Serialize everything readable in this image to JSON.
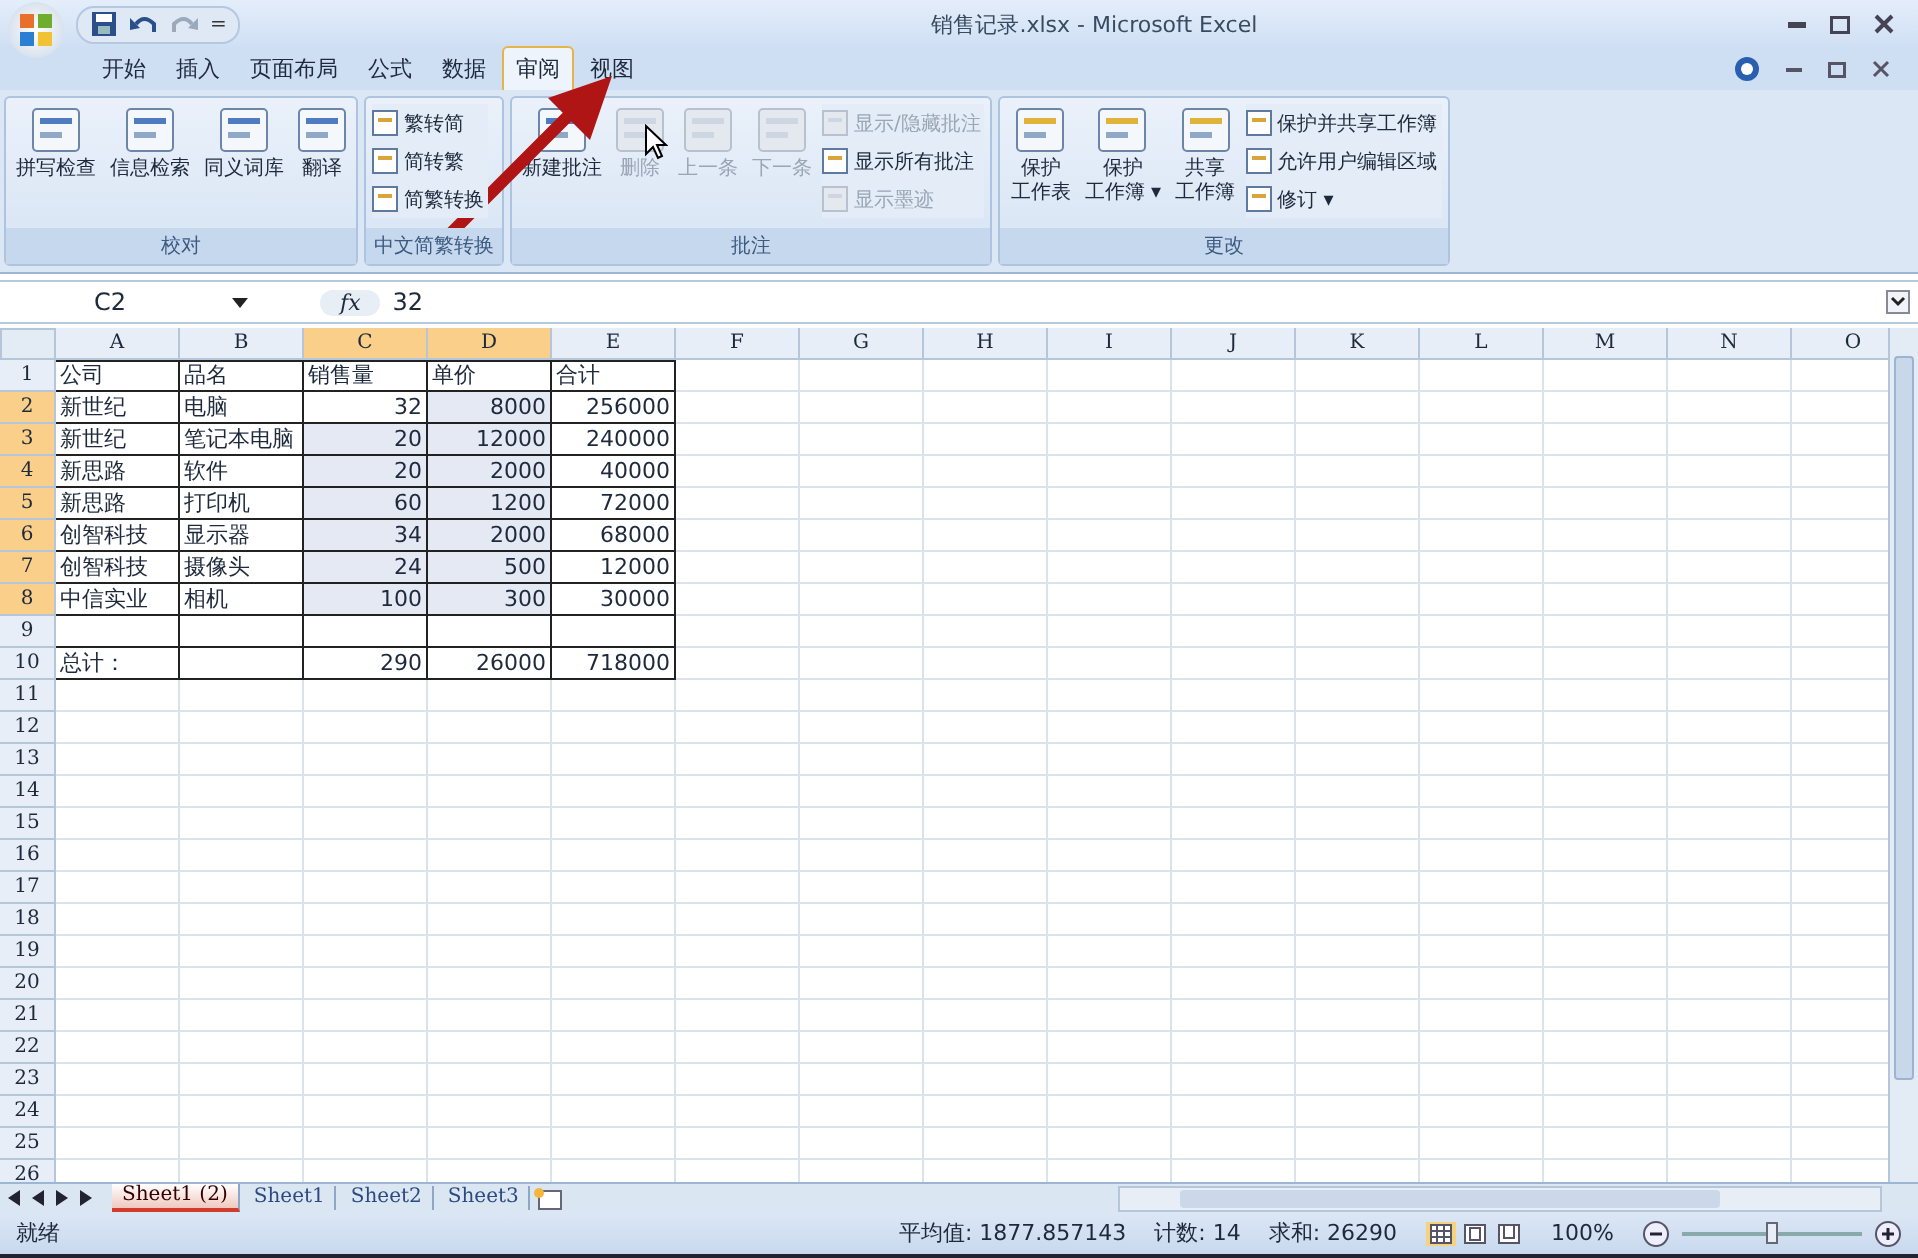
{
  "window": {
    "title": "销售记录.xlsx - Microsoft Excel"
  },
  "quick_access": {
    "customize": "="
  },
  "ribbon_tabs": [
    {
      "label": "开始",
      "selected": false
    },
    {
      "label": "插入",
      "selected": false
    },
    {
      "label": "页面布局",
      "selected": false
    },
    {
      "label": "公式",
      "selected": false
    },
    {
      "label": "数据",
      "selected": false
    },
    {
      "label": "审阅",
      "selected": true
    },
    {
      "label": "视图",
      "selected": false
    }
  ],
  "ribbon_groups": [
    {
      "label": "校对",
      "items": [
        {
          "kind": "large",
          "lines": [
            "拼写检查"
          ],
          "disabled": false
        },
        {
          "kind": "large",
          "lines": [
            "信息检索"
          ],
          "disabled": false
        },
        {
          "kind": "large",
          "lines": [
            "同义词库"
          ],
          "disabled": false
        },
        {
          "kind": "large",
          "lines": [
            "翻译"
          ],
          "disabled": false
        }
      ]
    },
    {
      "label": "中文简繁转换",
      "items": [
        {
          "kind": "small",
          "lines": [
            "繁转简"
          ],
          "disabled": false
        },
        {
          "kind": "small",
          "lines": [
            "简转繁"
          ],
          "disabled": false
        },
        {
          "kind": "small",
          "lines": [
            "简繁转换"
          ],
          "disabled": false
        }
      ]
    },
    {
      "label": "批注",
      "items": [
        {
          "kind": "large",
          "lines": [
            "新建批注"
          ],
          "disabled": false
        },
        {
          "kind": "large",
          "lines": [
            "删除"
          ],
          "disabled": true
        },
        {
          "kind": "large",
          "lines": [
            "上一条"
          ],
          "disabled": true
        },
        {
          "kind": "large",
          "lines": [
            "下一条"
          ],
          "disabled": true
        },
        {
          "kind": "small",
          "lines": [
            "显示/隐藏批注"
          ],
          "disabled": true
        },
        {
          "kind": "small",
          "lines": [
            "显示所有批注"
          ],
          "disabled": false
        },
        {
          "kind": "small",
          "lines": [
            "显示墨迹"
          ],
          "disabled": true
        }
      ]
    },
    {
      "label": "更改",
      "items": [
        {
          "kind": "large",
          "lines": [
            "保护",
            "工作表"
          ],
          "disabled": false
        },
        {
          "kind": "large",
          "lines": [
            "保护",
            "工作簿 ▾"
          ],
          "disabled": false
        },
        {
          "kind": "large",
          "lines": [
            "共享",
            "工作簿"
          ],
          "disabled": false
        },
        {
          "kind": "small",
          "lines": [
            "保护并共享工作簿"
          ],
          "disabled": false
        },
        {
          "kind": "small",
          "lines": [
            "允许用户编辑区域"
          ],
          "disabled": false
        },
        {
          "kind": "small",
          "lines": [
            "修订 ▾"
          ],
          "disabled": false
        }
      ]
    }
  ],
  "formula_bar": {
    "name_box": "C2",
    "fx": "fx",
    "value": "32"
  },
  "columns": [
    {
      "label": "A",
      "selected": false
    },
    {
      "label": "B",
      "selected": false
    },
    {
      "label": "C",
      "selected": true
    },
    {
      "label": "D",
      "selected": true
    },
    {
      "label": "E",
      "selected": false
    },
    {
      "label": "F",
      "selected": false
    },
    {
      "label": "G",
      "selected": false
    },
    {
      "label": "H",
      "selected": false
    },
    {
      "label": "I",
      "selected": false
    },
    {
      "label": "J",
      "selected": false
    },
    {
      "label": "K",
      "selected": false
    },
    {
      "label": "L",
      "selected": false
    },
    {
      "label": "M",
      "selected": false
    },
    {
      "label": "N",
      "selected": false
    },
    {
      "label": "O",
      "selected": false
    }
  ],
  "rows": [
    {
      "number": "1",
      "selected": false,
      "cells": [
        "公司",
        "品名",
        "销售量",
        "单价",
        "合计"
      ]
    },
    {
      "number": "2",
      "selected": true,
      "cells": [
        "新世纪",
        "电脑",
        "32",
        "8000",
        "256000"
      ]
    },
    {
      "number": "3",
      "selected": true,
      "cells": [
        "新世纪",
        "笔记本电脑",
        "20",
        "12000",
        "240000"
      ]
    },
    {
      "number": "4",
      "selected": true,
      "cells": [
        "新思路",
        "软件",
        "20",
        "2000",
        "40000"
      ]
    },
    {
      "number": "5",
      "selected": true,
      "cells": [
        "新思路",
        "打印机",
        "60",
        "1200",
        "72000"
      ]
    },
    {
      "number": "6",
      "selected": true,
      "cells": [
        "创智科技",
        "显示器",
        "34",
        "2000",
        "68000"
      ]
    },
    {
      "number": "7",
      "selected": true,
      "cells": [
        "创智科技",
        "摄像头",
        "24",
        "500",
        "12000"
      ]
    },
    {
      "number": "8",
      "selected": true,
      "cells": [
        "中信实业",
        "相机",
        "100",
        "300",
        "30000"
      ]
    },
    {
      "number": "9",
      "selected": false,
      "cells": [
        null,
        null,
        null,
        null,
        null
      ]
    },
    {
      "number": "10",
      "selected": false,
      "cells": [
        "总计：",
        null,
        "290",
        "26000",
        "718000"
      ]
    },
    {
      "number": "11",
      "selected": false
    },
    {
      "number": "12",
      "selected": false
    },
    {
      "number": "13",
      "selected": false
    },
    {
      "number": "14",
      "selected": false
    },
    {
      "number": "15",
      "selected": false
    },
    {
      "number": "16",
      "selected": false
    },
    {
      "number": "17",
      "selected": false
    },
    {
      "number": "18",
      "selected": false
    },
    {
      "number": "19",
      "selected": false
    },
    {
      "number": "20",
      "selected": false
    },
    {
      "number": "21",
      "selected": false
    },
    {
      "number": "22",
      "selected": false
    },
    {
      "number": "23",
      "selected": false
    },
    {
      "number": "24",
      "selected": false
    },
    {
      "number": "25",
      "selected": false
    },
    {
      "number": "26",
      "selected": false
    }
  ],
  "sheet_tabs": [
    {
      "label": "Sheet1 (2)",
      "selected": true
    },
    {
      "label": "Sheet1",
      "selected": false
    },
    {
      "label": "Sheet2",
      "selected": false
    },
    {
      "label": "Sheet3",
      "selected": false
    }
  ],
  "status_bar": {
    "status": "就绪",
    "average": "平均值: 1877.857143",
    "count": "计数: 14",
    "sum": "求和: 26290",
    "views": [
      {
        "selected": true
      },
      {
        "selected": false
      },
      {
        "selected": false
      }
    ],
    "zoom": "100%",
    "zoom_slider": {
      "level": 0.5
    }
  }
}
